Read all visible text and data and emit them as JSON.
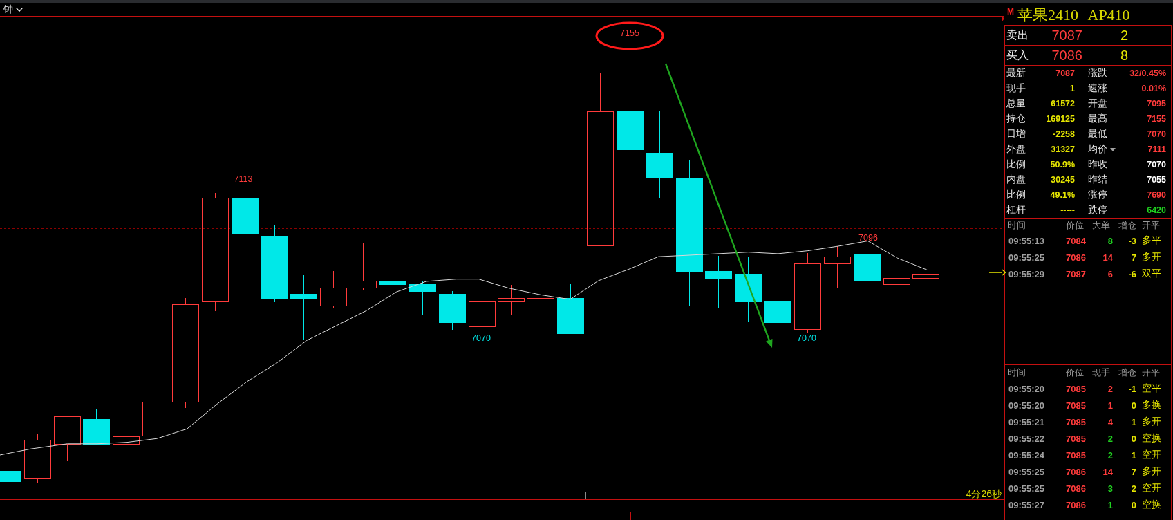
{
  "chart_header": {
    "period": "钟"
  },
  "chart": {
    "labels": [
      {
        "text": "7155",
        "kind": "high",
        "circled": true
      },
      {
        "text": "7113",
        "kind": "high",
        "circled": false
      },
      {
        "text": "7096",
        "kind": "high",
        "circled": false
      },
      {
        "text": "7070",
        "kind": "low",
        "circled": false
      },
      {
        "text": "7070",
        "kind": "low",
        "circled": false
      }
    ],
    "elapsed": "4分26秒"
  },
  "quote": {
    "badge": "M",
    "title": "苹果2410 AP410",
    "book": [
      {
        "label": "卖出",
        "price": "7087",
        "volume": "2"
      },
      {
        "label": "买入",
        "price": "7086",
        "volume": "8"
      }
    ],
    "stats": {
      "left": [
        {
          "label": "最新",
          "value": "7087",
          "color": "#ff3b3b"
        },
        {
          "label": "现手",
          "value": "1",
          "color": "#e6e600"
        },
        {
          "label": "总量",
          "value": "61572",
          "color": "#e6e600"
        },
        {
          "label": "持仓",
          "value": "169125",
          "color": "#e6e600"
        },
        {
          "label": "日增",
          "value": "-2258",
          "color": "#e6e600"
        },
        {
          "label": "外盘",
          "value": "31327",
          "color": "#e6e600"
        },
        {
          "label": "比例",
          "value": "50.9%",
          "color": "#e6e600"
        },
        {
          "label": "内盘",
          "value": "30245",
          "color": "#e6e600"
        },
        {
          "label": "比例",
          "value": "49.1%",
          "color": "#e6e600"
        },
        {
          "label": "杠杆",
          "value": "-----",
          "color": "#e6e600"
        }
      ],
      "right": [
        {
          "label": "涨跌",
          "value": "32/0.45%",
          "color": "#ff3b3b",
          "dropdown": false
        },
        {
          "label": "速涨",
          "value": "0.01%",
          "color": "#ff3b3b",
          "dropdown": false
        },
        {
          "label": "开盘",
          "value": "7095",
          "color": "#ff3b3b",
          "dropdown": false
        },
        {
          "label": "最高",
          "value": "7155",
          "color": "#ff3b3b",
          "dropdown": false
        },
        {
          "label": "最低",
          "value": "7070",
          "color": "#ff3b3b",
          "dropdown": false
        },
        {
          "label": "均价",
          "value": "7111",
          "color": "#ff3b3b",
          "dropdown": true
        },
        {
          "label": "昨收",
          "value": "7070",
          "color": "#ffffff",
          "dropdown": false
        },
        {
          "label": "昨结",
          "value": "7055",
          "color": "#ffffff",
          "dropdown": false
        },
        {
          "label": "涨停",
          "value": "7690",
          "color": "#ff3b3b",
          "dropdown": false
        },
        {
          "label": "跌停",
          "value": "6420",
          "color": "#20d020",
          "dropdown": false
        }
      ]
    }
  },
  "big_orders": {
    "columns": [
      "时间",
      "价位",
      "大单",
      "增仓",
      "开平"
    ],
    "rows": [
      {
        "time": "09:55:13",
        "price": "7084",
        "volume": "8",
        "color": "#20d020",
        "oi_change": "-3",
        "type": "多平"
      },
      {
        "time": "09:55:25",
        "price": "7086",
        "volume": "14",
        "color": "#ff3b3b",
        "oi_change": "7",
        "type": "多开"
      },
      {
        "time": "09:55:29",
        "price": "7087",
        "volume": "6",
        "color": "#ff3b3b",
        "oi_change": "-6",
        "type": "双平"
      }
    ]
  },
  "ticks": {
    "columns": [
      "时间",
      "价位",
      "现手",
      "增仓",
      "开平"
    ],
    "rows": [
      {
        "time": "09:55:20",
        "price": "7085",
        "volume": "2",
        "color": "#ff3b3b",
        "oi_change": "-1",
        "type": "空平"
      },
      {
        "time": "09:55:20",
        "price": "7085",
        "volume": "1",
        "color": "#ff3b3b",
        "oi_change": "0",
        "type": "多换"
      },
      {
        "time": "09:55:21",
        "price": "7085",
        "volume": "4",
        "color": "#ff3b3b",
        "oi_change": "1",
        "type": "多开"
      },
      {
        "time": "09:55:22",
        "price": "7085",
        "volume": "2",
        "color": "#20d020",
        "oi_change": "0",
        "type": "空换"
      },
      {
        "time": "09:55:24",
        "price": "7085",
        "volume": "2",
        "color": "#20d020",
        "oi_change": "1",
        "type": "空开"
      },
      {
        "time": "09:55:25",
        "price": "7086",
        "volume": "14",
        "color": "#ff3b3b",
        "oi_change": "7",
        "type": "多开"
      },
      {
        "time": "09:55:25",
        "price": "7086",
        "volume": "3",
        "color": "#20d020",
        "oi_change": "2",
        "type": "空开"
      },
      {
        "time": "09:55:27",
        "price": "7086",
        "volume": "1",
        "color": "#20d020",
        "oi_change": "0",
        "type": "空换"
      }
    ]
  }
}
